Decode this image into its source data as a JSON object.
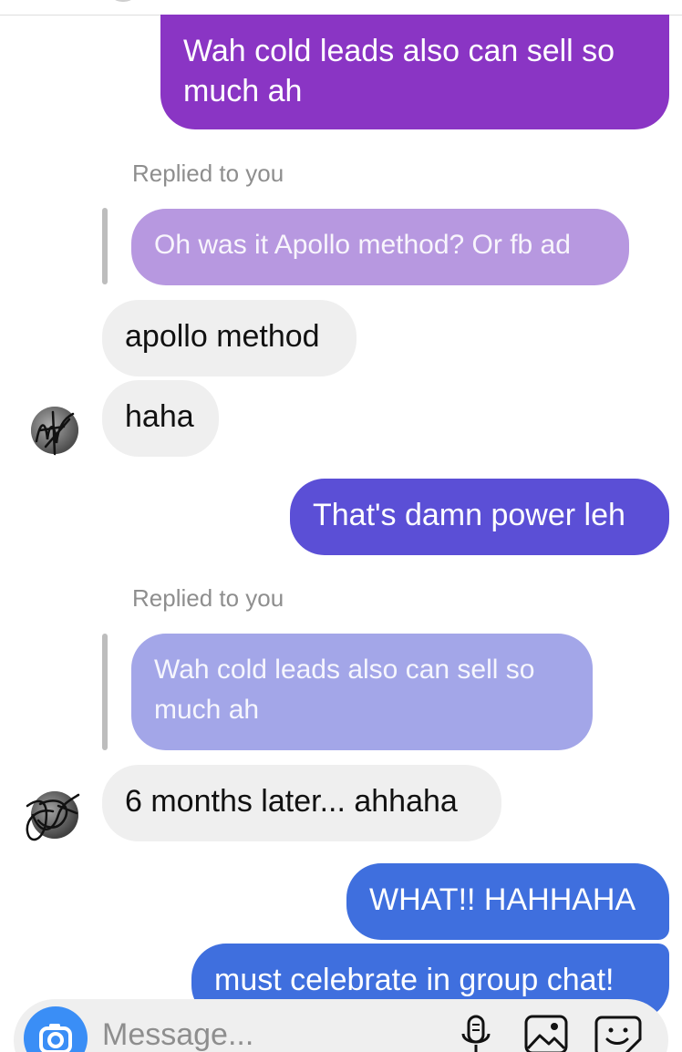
{
  "colors": {
    "purple_bubble": "#8a35c4",
    "indigo_bubble": "#5b4fd6",
    "blue_bubble": "#3f6fde",
    "quote_purple": "#b798e0",
    "quote_blue": "#a3a6e8",
    "incoming_bubble": "#efefef"
  },
  "messages": {
    "m1": {
      "text_line1": "Wah cold leads also can sell so",
      "text_line2": "much ah"
    },
    "r1": {
      "label": "Replied to you",
      "quote": "Oh was it Apollo method? Or fb ad"
    },
    "m2": {
      "text": "apollo method"
    },
    "m3": {
      "text": "haha"
    },
    "m4": {
      "text": "That's damn power leh"
    },
    "r2": {
      "label": "Replied to you",
      "quote_line1": "Wah cold leads also can sell so",
      "quote_line2": "much ah"
    },
    "m5": {
      "text": "6 months later... ahhaha"
    },
    "m6": {
      "text": "WHAT!! HAHHAHA"
    },
    "m7": {
      "text": "must celebrate in group chat!"
    }
  },
  "composer": {
    "placeholder": "Message...",
    "icons": [
      "camera-icon",
      "microphone-icon",
      "gallery-icon",
      "sticker-icon"
    ]
  }
}
